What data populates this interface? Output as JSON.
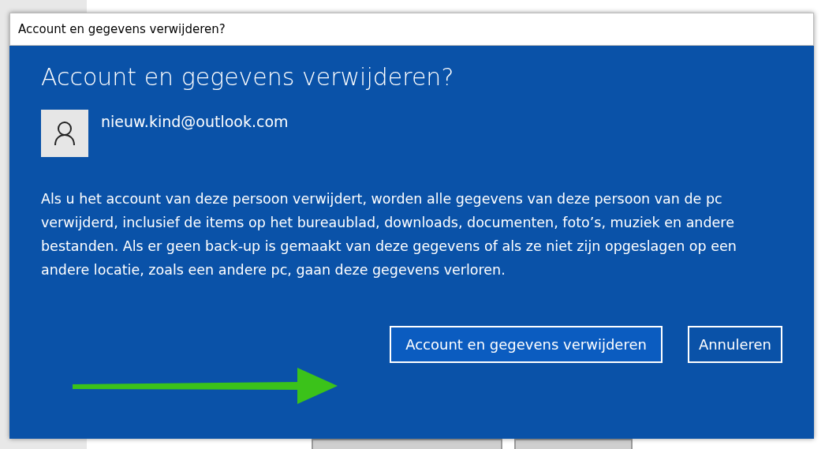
{
  "window": {
    "title": "Account en gegevens verwijderen?"
  },
  "dialog": {
    "heading": "Account en gegevens verwijderen?",
    "account": "nieuw.kind@outlook.com",
    "message": "Als u het account van deze persoon verwijdert, worden alle gegevens van deze persoon van de pc verwijderd, inclusief de items op het bureaublad, downloads, documenten, foto’s, muziek en andere bestanden. Als er geen back-up is gemaakt van deze gegevens of als ze niet zijn opgeslagen op een andere locatie, zoals een andere pc, gaan deze gegevens verloren.",
    "buttons": [
      {
        "label": "Account en gegevens verwijderen",
        "kind": "primary"
      },
      {
        "label": "Annuleren",
        "kind": "secondary"
      }
    ]
  }
}
